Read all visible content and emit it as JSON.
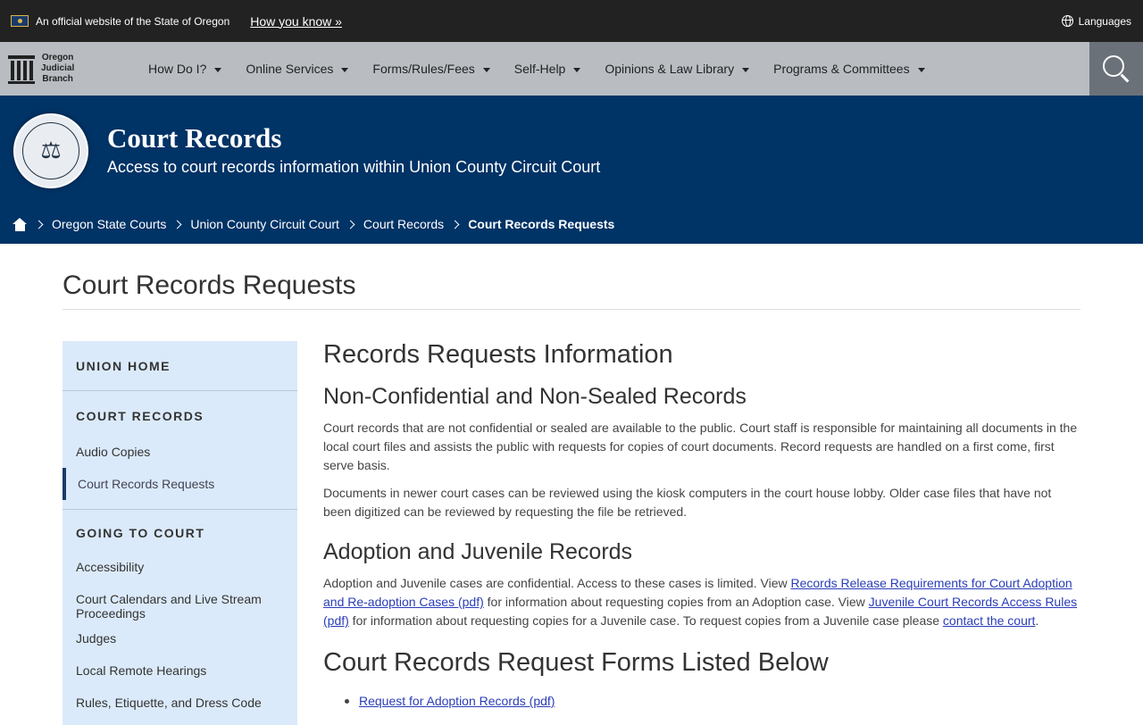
{
  "banner": {
    "official_text": "An official website of the State of Oregon",
    "how_you_know": "How you know »",
    "languages": "Languages"
  },
  "nav": {
    "logo_lines": [
      "Oregon",
      "Judicial",
      "Branch"
    ],
    "items": [
      {
        "label": "How Do I?"
      },
      {
        "label": "Online Services"
      },
      {
        "label": "Forms/Rules/Fees"
      },
      {
        "label": "Self-Help"
      },
      {
        "label": "Opinions & Law Library"
      },
      {
        "label": "Programs & Committees"
      }
    ]
  },
  "hero": {
    "title": "Court Records",
    "subtitle": "Access to court records information within Union County Circuit Court",
    "breadcrumbs": [
      "Oregon State Courts",
      "Union County Circuit Court",
      "Court Records",
      "Court Records Requests"
    ]
  },
  "page": {
    "title": "Court Records Requests"
  },
  "sidebar": {
    "sections": [
      {
        "heading": "UNION HOME",
        "items": []
      },
      {
        "heading": "COURT RECORDS",
        "items": [
          "Audio Copies",
          "Court Records Requests"
        ]
      },
      {
        "heading": "GOING TO COURT",
        "items": [
          "Accessibility",
          "Court Calendars and Live Stream Proceedings",
          "Judges",
          "Local Remote Hearings",
          "Rules, Etiquette, and Dress Code"
        ]
      }
    ]
  },
  "main": {
    "heading": "Records Requests Information",
    "s1": {
      "heading": "Non-Confidential and Non-Sealed Records",
      "p1": "Court records that are not confidential or sealed are available to the public. Court staff is responsible for maintaining all documents in the local court files and assists the public with requests for copies of court documents. Record requests are handled on a first come, first serve basis.",
      "p2": "Documents in newer court cases can be reviewed using the kiosk computers in the court house lobby. Older case files that have not been digitized can be reviewed by requesting the file be retrieved."
    },
    "s2": {
      "heading": "Adoption and Juvenile Records",
      "t1": "Adoption and Juvenile cases are confidential. Access to these cases is limited. View ",
      "link1": "Records Release Requirements for Court Adoption and Re-adoption Cases (pdf)",
      "t2": " for information about requesting copies from an Adoption case. View ",
      "link2": "Juvenile Court Records Access Rules (pdf)",
      "t3": " for information about requesting copies for a Juvenile case. To request copies from a Juvenile case please ",
      "link3": "contact the court",
      "t4": "."
    },
    "s3": {
      "heading": "Court Records Request Forms Listed Below",
      "forms": [
        "Request for Adoption Records (pdf)"
      ]
    }
  }
}
